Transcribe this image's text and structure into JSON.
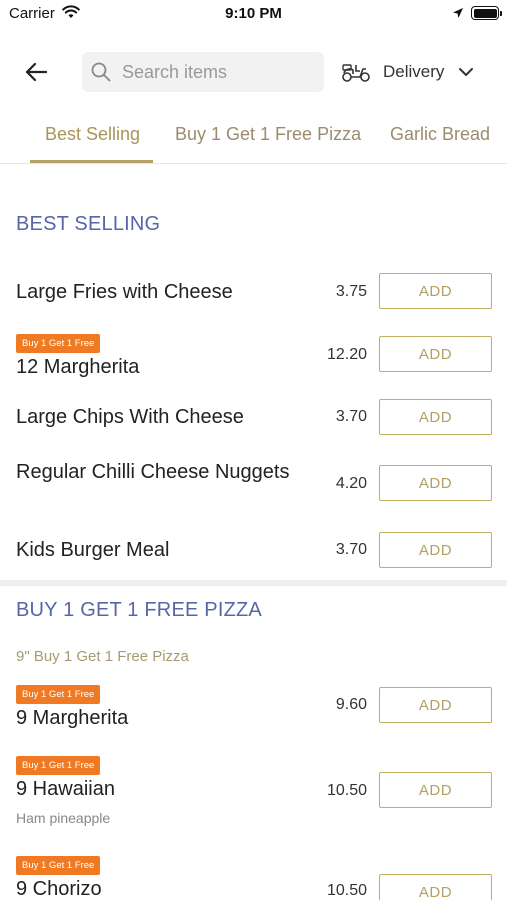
{
  "status_bar": {
    "carrier": "Carrier",
    "time": "9:10 PM"
  },
  "header": {
    "search_placeholder": "Search items",
    "delivery_label": "Delivery"
  },
  "tabs": [
    {
      "label": "Best Selling",
      "active": true
    },
    {
      "label": "Buy 1 Get 1 Free Pizza",
      "active": false
    },
    {
      "label": "Garlic Bread",
      "active": false
    }
  ],
  "colors": {
    "accent": "#b3a064",
    "section_title": "#5866a8",
    "badge": "#f07a24"
  },
  "sections": [
    {
      "title": "BEST SELLING",
      "items": [
        {
          "name": "Large Fries with Cheese",
          "price": "3.75",
          "add_label": "ADD"
        },
        {
          "badge": "Buy 1 Get 1 Free",
          "name": "12 Margherita",
          "price": "12.20",
          "add_label": "ADD"
        },
        {
          "name": "Large Chips With Cheese",
          "price": "3.70",
          "add_label": "ADD"
        },
        {
          "name": "Regular Chilli Cheese Nuggets",
          "price": "4.20",
          "add_label": "ADD"
        },
        {
          "name": "Kids Burger Meal",
          "price": "3.70",
          "add_label": "ADD"
        }
      ]
    },
    {
      "title": "BUY 1 GET 1 FREE PIZZA",
      "subtitle": "9\" Buy 1 Get 1 Free Pizza",
      "items": [
        {
          "badge": "Buy 1 Get 1 Free",
          "name": "9 Margherita",
          "price": "9.60",
          "add_label": "ADD"
        },
        {
          "badge": "Buy 1 Get 1 Free",
          "name": "9 Hawaiian",
          "description": "Ham pineapple",
          "price": "10.50",
          "add_label": "ADD"
        },
        {
          "badge": "Buy 1 Get 1 Free",
          "name": "9 Chorizo",
          "price": "10.50",
          "add_label": "ADD"
        }
      ]
    }
  ]
}
